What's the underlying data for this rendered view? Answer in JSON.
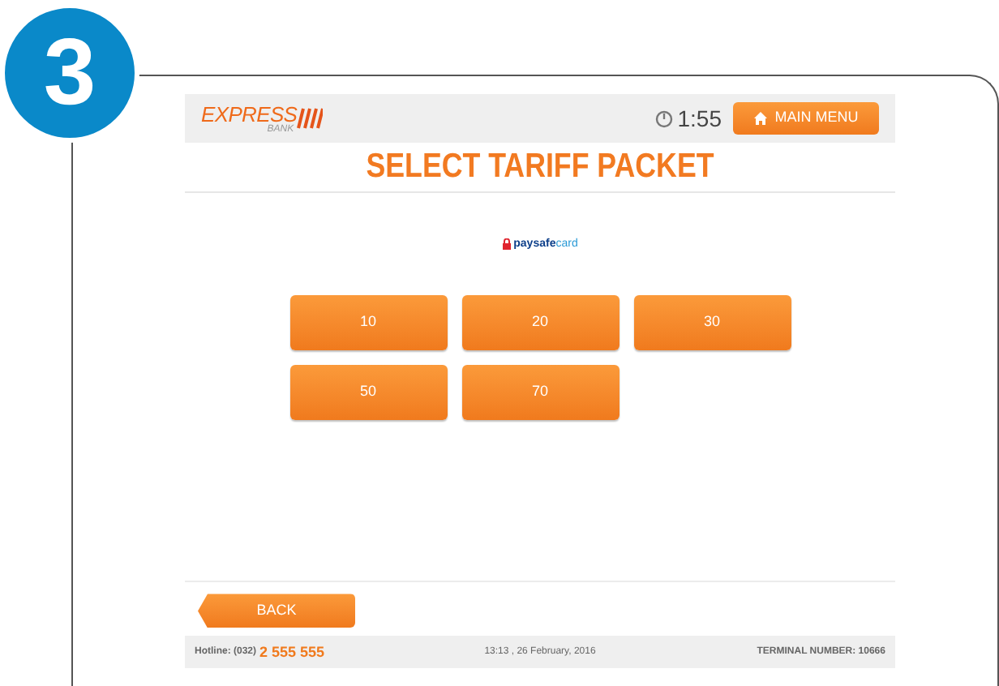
{
  "step": "3",
  "header": {
    "logo_top": "EXPRESS",
    "logo_bottom": "BANK",
    "timer": "1:55",
    "main_menu": "MAIN MENU"
  },
  "title": "SELECT TARIFF PACKET",
  "provider": {
    "name_bold": "paysafe",
    "name_light": "card"
  },
  "packets": [
    {
      "label": "10"
    },
    {
      "label": "20"
    },
    {
      "label": "30"
    },
    {
      "label": "50"
    },
    {
      "label": "70"
    }
  ],
  "back": "BACK",
  "footer": {
    "hotline_label": "Hotline: (032)",
    "hotline_number": "2 555 555",
    "datetime": "13:13 , 26 February, 2016",
    "terminal": "TERMINAL NUMBER: 10666"
  }
}
